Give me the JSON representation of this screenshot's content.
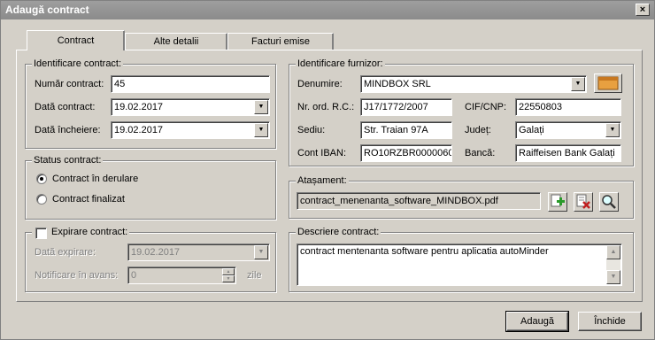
{
  "window": {
    "title": "Adaugă contract",
    "close": "×"
  },
  "tabs": [
    "Contract",
    "Alte detalii",
    "Facturi emise"
  ],
  "identificare": {
    "legend": "Identificare contract:",
    "numar_label": "Număr contract:",
    "numar_value": "45",
    "data_label": "Dată contract:",
    "data_value": "19.02.2017",
    "incheiere_label": "Dată încheiere:",
    "incheiere_value": "19.02.2017"
  },
  "status": {
    "legend": "Status contract:",
    "derulare": "Contract în derulare",
    "finalizat": "Contract finalizat",
    "selected": "derulare"
  },
  "expirare": {
    "legend": "Expirare contract:",
    "checked": false,
    "data_label": "Dată expirare:",
    "data_value": "19.02.2017",
    "notificare_label": "Notificare în avans:",
    "notificare_value": "0",
    "unit": "zile"
  },
  "furnizor": {
    "legend": "Identificare furnizor:",
    "denumire_label": "Denumire:",
    "denumire_value": "MINDBOX SRL",
    "nrord_label": "Nr. ord. R.C.:",
    "nrord_value": "J17/1772/2007",
    "cif_label": "CIF/CNP:",
    "cif_value": "22550803",
    "sediu_label": "Sediu:",
    "sediu_value": "Str. Traian 97A",
    "judet_label": "Județ:",
    "judet_value": "Galați",
    "iban_label": "Cont IBAN:",
    "iban_value": "RO10RZBR0000060",
    "banca_label": "Bancă:",
    "banca_value": "Raiffeisen Bank Galați"
  },
  "atasament": {
    "legend": "Atașament:",
    "file": "contract_menenanta_software_MINDBOX.pdf"
  },
  "descriere": {
    "legend": "Descriere contract:",
    "text": "contract mentenanta software pentru aplicatia autoMinder"
  },
  "buttons": {
    "add": "Adaugă",
    "close": "Închide"
  }
}
